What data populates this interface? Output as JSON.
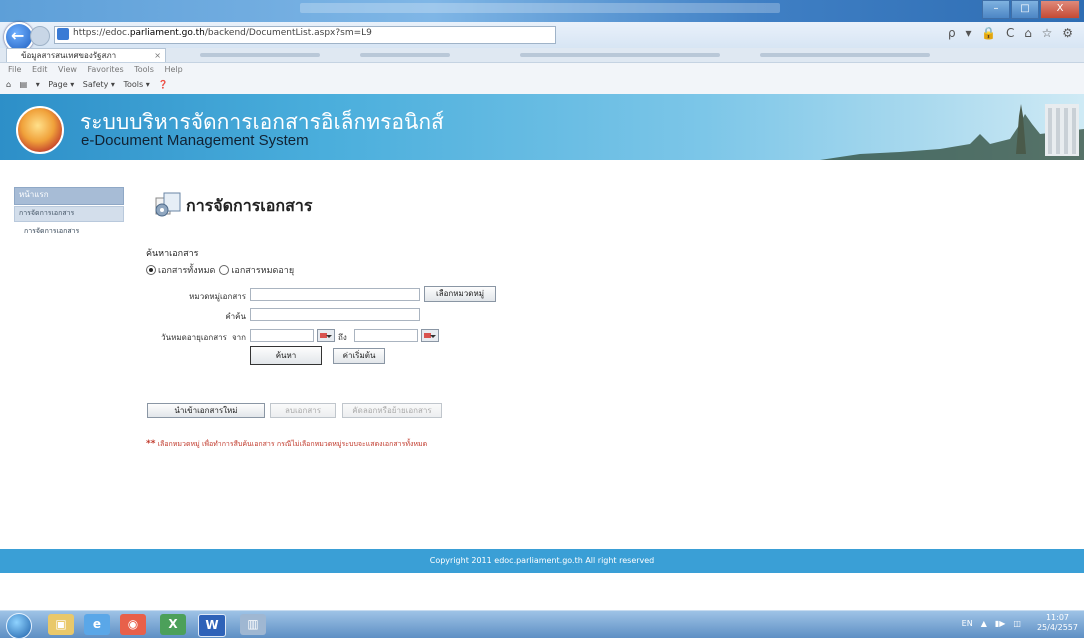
{
  "browser": {
    "url_prefix": "https://edoc.",
    "url_host": "parliament.go.th",
    "url_path": "/backend/DocumentList.aspx?sm=L9",
    "tab_label": "ข้อมูลสารสนเทศของรัฐสภา",
    "tab_close": "×",
    "menu": [
      "File",
      "Edit",
      "View",
      "Favorites",
      "Tools",
      "Help"
    ],
    "command_bar": [
      "▾",
      "Page ▾",
      "Safety ▾",
      "Tools ▾"
    ],
    "window_buttons": [
      "–",
      "□",
      "X"
    ],
    "address_icons": "ρ ▾ 🔒 C  ⌂ ☆ ⚙"
  },
  "header": {
    "title": "ระบบบริหารจัดการเอกสารอิเล็กทรอนิกส์",
    "subtitle": "e-Document Management System"
  },
  "sidebar": {
    "home": "หน้าแรก",
    "section": "การจัดการเอกสาร",
    "item": "การจัดการเอกสาร"
  },
  "main": {
    "page_title": "การจัดการเอกสาร",
    "search_heading": "ค้นหาเอกสาร",
    "radio_all": "เอกสารทั้งหมด",
    "radio_expired": "เอกสารหมดอายุ",
    "radio_all_checked": true,
    "category_label": "หมวดหมู่เอกสาร",
    "category_value": "",
    "choose_category_button": "เลือกหมวดหมู่",
    "keyword_label": "คำค้น",
    "keyword_value": "",
    "expiry_label": "วันหมดอายุเอกสาร",
    "from_label": "จาก",
    "to_label": "ถึง",
    "from_value": "",
    "to_value": "",
    "search_button": "ค้นหา",
    "reset_button": "ค่าเริ่มต้น",
    "import_button": "นำเข้าเอกสารใหม่",
    "delete_button": "ลบเอกสาร",
    "copy_button": "คัดลอกหรือย้ายเอกสาร",
    "note_marker": "**",
    "note_text": "เลือกหมวดหมู่ เพื่อทำการสืบค้นเอกสาร กรณีไม่เลือกหมวดหมู่ระบบจะแสดงเอกสารทั้งหมด"
  },
  "footer": {
    "copyright": "Copyright 2011 edoc.parliament.go.th All right reserved"
  },
  "taskbar": {
    "word_label": "W",
    "lang": "EN",
    "time": "11:07",
    "date": "25/4/2557"
  },
  "colors": {
    "header_blue": "#2d8fc8",
    "footer_blue": "#3a9fd6",
    "note_red": "#c0392b"
  }
}
